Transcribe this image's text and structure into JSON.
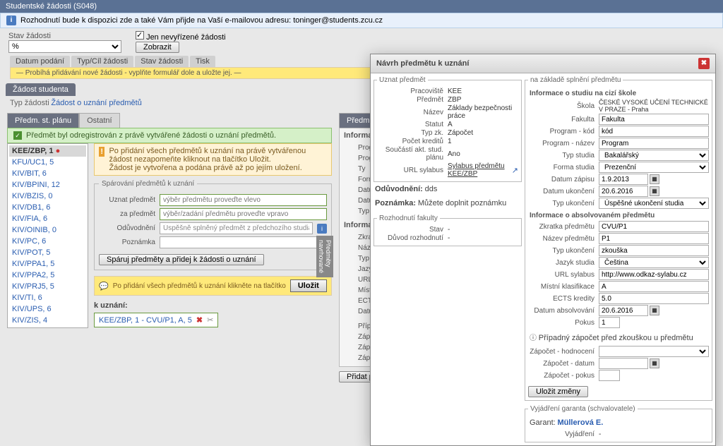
{
  "window": {
    "title": "Studentské žádosti (S048)"
  },
  "notice": "Rozhodnutí bude k dispozici zde a také Vám přijde na Vaší e-mailovou adresu: toninger@students.zcu.cz",
  "filter": {
    "stav_label": "Stav žádosti",
    "stav_value": "%",
    "only_pending": "Jen nevyřízené žádosti",
    "show_btn": "Zobrazit"
  },
  "cols": [
    "Datum podání",
    "Typ/Cíl žádosti",
    "Stav žádosti",
    "Tisk"
  ],
  "yellow_strip": "— Probíhá přidávání nové žádosti - vyplňte formulář dole a uložte jej. —",
  "section_tab": "Žádost studenta",
  "type_row": {
    "label": "Typ žádosti",
    "link": "Žádost o uznání předmětů"
  },
  "tabs2": {
    "plan": "Předm. st. plánu",
    "other": "Ostatní"
  },
  "green_banner": "Předmět byl odregistrován z právě vytvářené žádosti o uznání předmětů.",
  "subjects": [
    "KEE/ZBP, 1",
    "KFU/UC1, 5",
    "KIV/BIT, 6",
    "KIV/BPINI, 12",
    "KIV/BZIS, 0",
    "KIV/DB1, 6",
    "KIV/FIA, 6",
    "KIV/OINIB, 0",
    "KIV/PC, 6",
    "KIV/POT, 5",
    "KIV/PPA1, 5",
    "KIV/PPA2, 5",
    "KIV/PRJ5, 5",
    "KIV/TI, 6",
    "KIV/UPS, 6",
    "KIV/ZIS, 4"
  ],
  "warn": "Po přidání všech předmětů k uznání na právě vytvářenou žádost nezapomeňte kliknout na tlačítko Uložit.\nŽádost je vytvořena a podána právě až po jejím uložení.",
  "pair": {
    "legend": "Spárování předmětů k uznání",
    "uznat_label": "Uznat předmět",
    "uznat_ph": "výběr předmětu proveďte vlevo",
    "za_label": "za předmět",
    "za_ph": "výběr/zadání předmětu proveďte vpravo",
    "oduv_label": "Odůvodnění",
    "oduv_val": "Úspěšně splněný předmět z předchozího studia",
    "pozn_label": "Poznámka",
    "btn": "Spáruj předměty a přidej k žádosti o uznání"
  },
  "save_hint": "Po přidání všech předmětů k uznání klikněte na tlačítko",
  "save_btn": "Uložit",
  "side_label": "Předměty\nnavrhované",
  "k_uznani": "k uznání:",
  "chip": "KEE/ZBP, 1 - CVU/P1, A, 5",
  "right_tabs": {
    "spl": "Předm. spln"
  },
  "right_cut": {
    "hdr": "Informace o",
    "rows": [
      "Program",
      "Program",
      "Ty",
      "Form",
      "Datu",
      "Datum u",
      "Typ u"
    ],
    "hdr2": "Informace o",
    "rows2": [
      "Zkratka př",
      "Název př",
      "Typ u",
      "Jazy",
      "URL",
      "Místní kl",
      "ECTS",
      "Datum abs"
    ],
    "extra": [
      "Případný z",
      "Zápočet - ho",
      "Zápočet -",
      "Zápočet"
    ]
  },
  "btn_add": "Přidat předmět k spárování",
  "modal": {
    "title": "Návrh předmětu k uznání",
    "left_legend": "Uznat předmět",
    "left_rows": {
      "prac_l": "Pracoviště",
      "prac_v": "KEE",
      "pred_l": "Předmět",
      "pred_v": "ZBP",
      "naz_l": "Název",
      "naz_v": "Základy bezpečnosti práce",
      "stat_l": "Statut",
      "stat_v": "A",
      "typ_l": "Typ zk.",
      "typ_v": "Zápočet",
      "kred_l": "Počet kreditů",
      "kred_v": "1",
      "souc_l": "Součástí akt. stud. plánu",
      "souc_v": "Ano",
      "url_l": "URL sylabus",
      "url_v": "Sylabus předmětu KEE/ZBP"
    },
    "oduv_l": "Odůvodnění:",
    "oduv_v": "dds",
    "pozn_l": "Poznámka:",
    "pozn_v": "Můžete doplnit poznámku",
    "right_legend": "na základě splnění předmětu",
    "r1_title": "Informace o studiu na cizí škole",
    "r1": {
      "skola_l": "Škola",
      "skola_v": "ČESKÉ VYSOKÉ UČENÍ TECHNICKÉ V PRAZE - Praha",
      "fak_l": "Fakulta",
      "fak_v": "Fakulta",
      "pkod_l": "Program - kód",
      "pkod_v": "kód",
      "pnaz_l": "Program - název",
      "pnaz_v": "Program",
      "typs_l": "Typ studia",
      "typs_v": "Bakalářský",
      "form_l": "Forma studia",
      "form_v": "Prezenční",
      "dzap_l": "Datum zápisu",
      "dzap_v": "1.9.2013",
      "duk_l": "Datum ukončení",
      "duk_v": "20.6.2016",
      "typu_l": "Typ ukončení",
      "typu_v": "Úspěšné ukončení studia"
    },
    "r2_title": "Informace o absolvovaném předmětu",
    "r2": {
      "zkr_l": "Zkratka předmětu",
      "zkr_v": "CVU/P1",
      "naz_l": "Název předmětu",
      "naz_v": "P1",
      "typu_l": "Typ ukončení",
      "typu_v": "zkouška",
      "jaz_l": "Jazyk studia",
      "jaz_v": "Čeština",
      "url_l": "URL sylabus",
      "url_v": "http://www.odkaz-sylabu.cz",
      "mkl_l": "Místní klasifikace",
      "mkl_v": "A",
      "ects_l": "ECTS kredity",
      "ects_v": "5.0",
      "dabs_l": "Datum absolvování",
      "dabs_v": "20.6.2016",
      "pok_l": "Pokus",
      "pok_v": "1"
    },
    "zap_note": "Případný zápočet před zkouškou u předmětu",
    "zap_h_l": "Zápočet - hodnocení",
    "zap_d_l": "Zápočet - datum",
    "zap_p_l": "Zápočet - pokus",
    "save": "Uložit změny",
    "fac_legend": "Rozhodnutí fakulty",
    "fac_stav_l": "Stav",
    "fac_stav_v": "-",
    "fac_duv_l": "Důvod rozhodnutí",
    "fac_duv_v": "-",
    "gar_legend": "Vyjádření garanta (schvalovatele)",
    "gar_l": "Garant:",
    "gar_v": "Müllerová E.",
    "vyj_l": "Vyjádření",
    "vyj_v": "-"
  }
}
